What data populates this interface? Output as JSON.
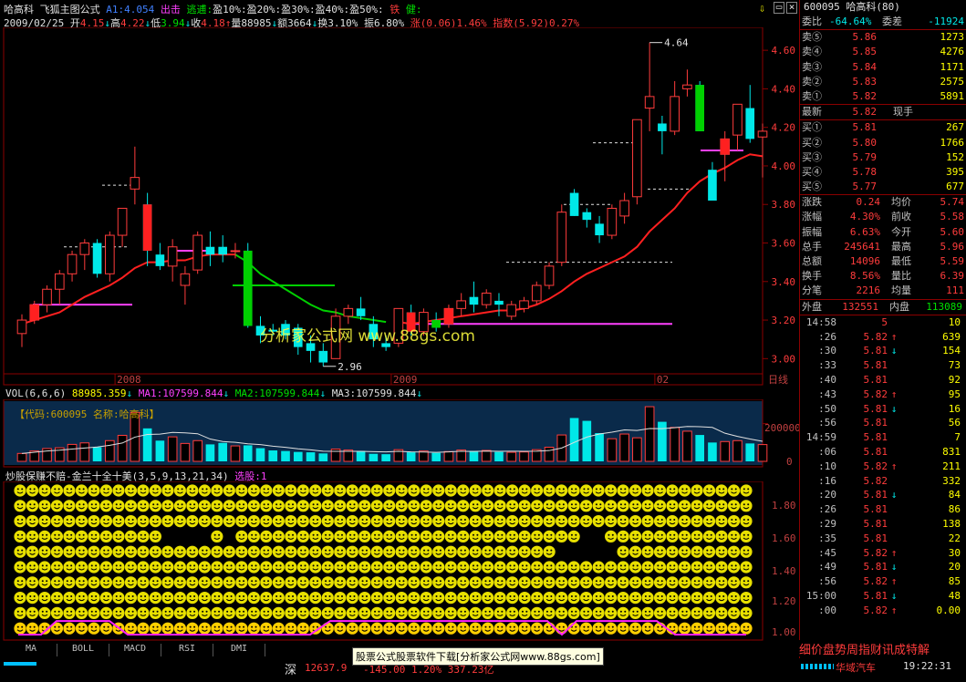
{
  "header": {
    "stock_name": "哈高科",
    "formula_name": "飞狐主图公式",
    "a1_label": "A1:",
    "a1_value": "4.054",
    "exit_label": "出击",
    "escape_label": "逃逋:",
    "profit_levels": [
      "盈10%:",
      "盈20%:",
      "盈30%:",
      "盈40%:",
      "盈50%:"
    ],
    "iron_label": "铁",
    "health_label": "健:",
    "date": "2009/02/25",
    "open_label": "开",
    "open": "4.15",
    "high_label": "高",
    "high": "4.22",
    "low_label": "低",
    "low": "3.94",
    "close_label": "收",
    "close": "4.18",
    "vol_label": "量",
    "vol": "88985",
    "amt_label": "额",
    "amt": "3664",
    "turnover_label": "换",
    "turnover": "3.10%",
    "amp_label": "振",
    "amp": "6.80%",
    "change": "涨(0.06)1.46%",
    "index_label": "指数(5.92)0.27%"
  },
  "price_axis": [
    "4.60",
    "4.40",
    "4.20",
    "4.00",
    "3.80",
    "3.60",
    "3.40",
    "3.20",
    "3.00"
  ],
  "price_annotations": {
    "high_mark": "4.64",
    "low_mark": "2.96"
  },
  "date_axis": [
    "2008",
    "2009",
    "02"
  ],
  "period_label": "日线",
  "volume_panel": {
    "title": "VOL(6,6,6)",
    "vol": "88985.359",
    "ma1_label": "MA1:",
    "ma1": "107599.844",
    "ma2_label": "MA2:",
    "ma2": "107599.844",
    "ma3_label": "MA3:",
    "ma3": "107599.844",
    "code_label": "【代码:600095 名称:哈高科】",
    "axis": "200000",
    "axis_zero": "0"
  },
  "indicator_panel": {
    "title": "炒股保赚不赔-金兰十全十美",
    "params": "(3,5,9,13,21,34)",
    "pick_label": "选股:1",
    "axis": [
      "1.80",
      "1.60",
      "1.40",
      "1.20",
      "1.00"
    ]
  },
  "tabs": [
    "MA",
    "BOLL",
    "MACD",
    "RSI",
    "DMI"
  ],
  "watermark": "分析家公式网 www.88gs.com",
  "status": {
    "market": "深",
    "index_value": "12637.9",
    "tail": "-145.00  1.20%  337.23亿",
    "banner": "股票公式股票软件下载[分析家公式网www.88gs.com]",
    "car_label": "华域汽车",
    "time": "19:22:31"
  },
  "quote": {
    "code": "600095",
    "name": "哈高科(80)",
    "weibi_label": "委比",
    "weibi": "-64.64%",
    "weicha_label": "委差",
    "weicha": "-11924",
    "asks": [
      {
        "label": "卖⑤",
        "price": "5.86",
        "qty": "1273"
      },
      {
        "label": "卖④",
        "price": "5.85",
        "qty": "4276"
      },
      {
        "label": "卖③",
        "price": "5.84",
        "qty": "1171"
      },
      {
        "label": "卖②",
        "price": "5.83",
        "qty": "2575"
      },
      {
        "label": "卖①",
        "price": "5.82",
        "qty": "5891"
      }
    ],
    "latest_label": "最新",
    "latest": "5.82",
    "xianshou_label": "现手",
    "bids": [
      {
        "label": "买①",
        "price": "5.81",
        "qty": "267"
      },
      {
        "label": "买②",
        "price": "5.80",
        "qty": "1766"
      },
      {
        "label": "买③",
        "price": "5.79",
        "qty": "152"
      },
      {
        "label": "买④",
        "price": "5.78",
        "qty": "395"
      },
      {
        "label": "买⑤",
        "price": "5.77",
        "qty": "677"
      }
    ],
    "stats": [
      {
        "k1": "涨跌",
        "v1": "0.24",
        "k2": "均价",
        "v2": "5.74"
      },
      {
        "k1": "涨幅",
        "v1": "4.30%",
        "k2": "前收",
        "v2": "5.58"
      },
      {
        "k1": "振幅",
        "v1": "6.63%",
        "k2": "今开",
        "v2": "5.60"
      },
      {
        "k1": "总手",
        "v1": "245641",
        "k2": "最高",
        "v2": "5.96"
      },
      {
        "k1": "总额",
        "v1": "14096",
        "k2": "最低",
        "v2": "5.59"
      },
      {
        "k1": "换手",
        "v1": "8.56%",
        "k2": "量比",
        "v2": "6.39"
      },
      {
        "k1": "分笔",
        "v1": "2216",
        "k2": "均量",
        "v2": "111"
      }
    ],
    "outer_label": "外盘",
    "outer": "132551",
    "inner_label": "内盘",
    "inner": "113089"
  },
  "ticks": [
    {
      "t": "14:58",
      "p": "5",
      "a": "",
      "q": "10"
    },
    {
      "t": ":26",
      "p": "5.82",
      "a": "↑",
      "q": "639"
    },
    {
      "t": ":30",
      "p": "5.81",
      "a": "↓",
      "q": "154"
    },
    {
      "t": ":33",
      "p": "5.81",
      "a": "",
      "q": "73"
    },
    {
      "t": ":40",
      "p": "5.81",
      "a": "",
      "q": "92"
    },
    {
      "t": ":43",
      "p": "5.82",
      "a": "↑",
      "q": "95"
    },
    {
      "t": ":50",
      "p": "5.81",
      "a": "↓",
      "q": "16"
    },
    {
      "t": ":56",
      "p": "5.81",
      "a": "",
      "q": "56"
    },
    {
      "t": "14:59",
      "p": "5.81",
      "a": "",
      "q": "7"
    },
    {
      "t": ":06",
      "p": "5.81",
      "a": "",
      "q": "831"
    },
    {
      "t": ":10",
      "p": "5.82",
      "a": "↑",
      "q": "211"
    },
    {
      "t": ":16",
      "p": "5.82",
      "a": "",
      "q": "332"
    },
    {
      "t": ":20",
      "p": "5.81",
      "a": "↓",
      "q": "84"
    },
    {
      "t": ":26",
      "p": "5.81",
      "a": "",
      "q": "86"
    },
    {
      "t": ":29",
      "p": "5.81",
      "a": "",
      "q": "138"
    },
    {
      "t": ":35",
      "p": "5.81",
      "a": "",
      "q": "22"
    },
    {
      "t": ":45",
      "p": "5.82",
      "a": "↑",
      "q": "30"
    },
    {
      "t": ":49",
      "p": "5.81",
      "a": "↓",
      "q": "20"
    },
    {
      "t": ":56",
      "p": "5.82",
      "a": "↑",
      "q": "85"
    },
    {
      "t": "15:00",
      "p": "5.81",
      "a": "↓",
      "q": "48"
    },
    {
      "t": ":00",
      "p": "5.82",
      "a": "↑",
      "q": "0.00"
    }
  ],
  "bottom_tabs": "细价盘势周指财讯成特解",
  "colors": {
    "up": "#ff3c3c",
    "down": "#00e8e8",
    "ma": "#ff2020",
    "ma_green": "#00d000",
    "magenta": "#ff40ff"
  },
  "chart_data": {
    "type": "candlestick",
    "y_range": [
      2.94,
      4.7
    ],
    "candles": [
      {
        "o": 3.13,
        "h": 3.23,
        "l": 3.06,
        "c": 3.2
      },
      {
        "o": 3.2,
        "h": 3.3,
        "l": 3.18,
        "c": 3.28
      },
      {
        "o": 3.28,
        "h": 3.38,
        "l": 3.24,
        "c": 3.36
      },
      {
        "o": 3.36,
        "h": 3.46,
        "l": 3.28,
        "c": 3.44
      },
      {
        "o": 3.44,
        "h": 3.56,
        "l": 3.4,
        "c": 3.54
      },
      {
        "o": 3.54,
        "h": 3.62,
        "l": 3.46,
        "c": 3.6
      },
      {
        "o": 3.6,
        "h": 3.62,
        "l": 3.42,
        "c": 3.44
      },
      {
        "o": 3.44,
        "h": 3.66,
        "l": 3.4,
        "c": 3.64
      },
      {
        "o": 3.64,
        "h": 3.78,
        "l": 3.58,
        "c": 3.78
      },
      {
        "o": 3.88,
        "h": 4.1,
        "l": 3.8,
        "c": 3.94
      },
      {
        "o": 3.8,
        "h": 3.86,
        "l": 3.48,
        "c": 3.56
      },
      {
        "o": 3.54,
        "h": 3.6,
        "l": 3.46,
        "c": 3.48
      },
      {
        "o": 3.48,
        "h": 3.62,
        "l": 3.4,
        "c": 3.58
      },
      {
        "o": 3.38,
        "h": 3.48,
        "l": 3.28,
        "c": 3.44
      },
      {
        "o": 3.46,
        "h": 3.66,
        "l": 3.44,
        "c": 3.64
      },
      {
        "o": 3.58,
        "h": 3.66,
        "l": 3.48,
        "c": 3.54
      },
      {
        "o": 3.58,
        "h": 3.64,
        "l": 3.5,
        "c": 3.54
      },
      {
        "o": 3.56,
        "h": 3.6,
        "l": 3.52,
        "c": 3.56
      },
      {
        "o": 3.56,
        "h": 3.6,
        "l": 3.16,
        "c": 3.17
      },
      {
        "o": 3.17,
        "h": 3.22,
        "l": 3.08,
        "c": 3.12
      },
      {
        "o": 3.15,
        "h": 3.18,
        "l": 3.12,
        "c": 3.14
      },
      {
        "o": 3.18,
        "h": 3.2,
        "l": 3.1,
        "c": 3.12
      },
      {
        "o": 3.16,
        "h": 3.18,
        "l": 3.02,
        "c": 3.06
      },
      {
        "o": 3.08,
        "h": 3.12,
        "l": 2.98,
        "c": 3.04
      },
      {
        "o": 3.04,
        "h": 3.08,
        "l": 2.96,
        "c": 2.98
      },
      {
        "o": 3.0,
        "h": 3.26,
        "l": 3.0,
        "c": 3.22
      },
      {
        "o": 3.22,
        "h": 3.28,
        "l": 3.18,
        "c": 3.26
      },
      {
        "o": 3.26,
        "h": 3.32,
        "l": 3.2,
        "c": 3.22
      },
      {
        "o": 3.18,
        "h": 3.22,
        "l": 3.06,
        "c": 3.1
      },
      {
        "o": 3.08,
        "h": 3.12,
        "l": 3.04,
        "c": 3.06
      },
      {
        "o": 3.08,
        "h": 3.26,
        "l": 3.06,
        "c": 3.26
      },
      {
        "o": 3.24,
        "h": 3.28,
        "l": 3.12,
        "c": 3.14
      },
      {
        "o": 3.14,
        "h": 3.26,
        "l": 3.12,
        "c": 3.24
      },
      {
        "o": 3.2,
        "h": 3.24,
        "l": 3.14,
        "c": 3.16
      },
      {
        "o": 3.18,
        "h": 3.28,
        "l": 3.16,
        "c": 3.26
      },
      {
        "o": 3.26,
        "h": 3.34,
        "l": 3.22,
        "c": 3.3
      },
      {
        "o": 3.32,
        "h": 3.4,
        "l": 3.24,
        "c": 3.28
      },
      {
        "o": 3.28,
        "h": 3.36,
        "l": 3.26,
        "c": 3.34
      },
      {
        "o": 3.3,
        "h": 3.34,
        "l": 3.22,
        "c": 3.28
      },
      {
        "o": 3.22,
        "h": 3.3,
        "l": 3.2,
        "c": 3.28
      },
      {
        "o": 3.26,
        "h": 3.32,
        "l": 3.24,
        "c": 3.3
      },
      {
        "o": 3.3,
        "h": 3.4,
        "l": 3.28,
        "c": 3.38
      },
      {
        "o": 3.38,
        "h": 3.5,
        "l": 3.36,
        "c": 3.48
      },
      {
        "o": 3.5,
        "h": 3.8,
        "l": 3.48,
        "c": 3.76
      },
      {
        "o": 3.86,
        "h": 3.88,
        "l": 3.74,
        "c": 3.74
      },
      {
        "o": 3.76,
        "h": 3.78,
        "l": 3.68,
        "c": 3.72
      },
      {
        "o": 3.7,
        "h": 3.74,
        "l": 3.6,
        "c": 3.64
      },
      {
        "o": 3.64,
        "h": 3.8,
        "l": 3.62,
        "c": 3.78
      },
      {
        "o": 3.74,
        "h": 3.86,
        "l": 3.7,
        "c": 3.82
      },
      {
        "o": 3.84,
        "h": 4.24,
        "l": 3.8,
        "c": 4.24
      },
      {
        "o": 4.3,
        "h": 4.64,
        "l": 4.18,
        "c": 4.36
      },
      {
        "o": 4.22,
        "h": 4.26,
        "l": 4.06,
        "c": 4.18
      },
      {
        "o": 4.18,
        "h": 4.44,
        "l": 4.16,
        "c": 4.36
      },
      {
        "o": 4.4,
        "h": 4.5,
        "l": 4.36,
        "c": 4.42
      },
      {
        "o": 4.42,
        "h": 4.44,
        "l": 4.18,
        "c": 4.18
      },
      {
        "o": 3.98,
        "h": 4.02,
        "l": 3.82,
        "c": 3.82
      },
      {
        "o": 4.06,
        "h": 4.18,
        "l": 3.92,
        "c": 4.14
      },
      {
        "o": 4.16,
        "h": 4.32,
        "l": 4.08,
        "c": 4.32
      },
      {
        "o": 4.3,
        "h": 4.42,
        "l": 4.12,
        "c": 4.14
      },
      {
        "o": 4.15,
        "h": 4.22,
        "l": 3.94,
        "c": 4.18
      }
    ],
    "ma": [
      3.18,
      3.2,
      3.22,
      3.24,
      3.28,
      3.32,
      3.35,
      3.38,
      3.42,
      3.47,
      3.5,
      3.5,
      3.51,
      3.51,
      3.53,
      3.54,
      3.54,
      3.54,
      3.5,
      3.44,
      3.4,
      3.36,
      3.32,
      3.28,
      3.25,
      3.24,
      3.22,
      3.21,
      3.2,
      3.19,
      3.19,
      3.18,
      3.19,
      3.2,
      3.21,
      3.22,
      3.23,
      3.24,
      3.25,
      3.25,
      3.26,
      3.28,
      3.31,
      3.35,
      3.4,
      3.44,
      3.47,
      3.5,
      3.53,
      3.58,
      3.66,
      3.72,
      3.78,
      3.86,
      3.92,
      3.96,
      3.99,
      4.03,
      4.06,
      4.05
    ],
    "volumes": [
      42000,
      55000,
      68000,
      72000,
      90000,
      98000,
      75000,
      110000,
      138000,
      260000,
      175000,
      110000,
      130000,
      95000,
      110000,
      90000,
      98000,
      82000,
      85000,
      70000,
      58000,
      55000,
      50000,
      48000,
      42000,
      65000,
      60000,
      55000,
      40000,
      38000,
      62000,
      48000,
      55000,
      45000,
      52000,
      60000,
      55000,
      58000,
      50000,
      48000,
      50000,
      62000,
      75000,
      140000,
      230000,
      215000,
      150000,
      120000,
      145000,
      125000,
      290000,
      210000,
      180000,
      160000,
      140000,
      100000,
      105000,
      110000,
      95000,
      88985
    ]
  }
}
